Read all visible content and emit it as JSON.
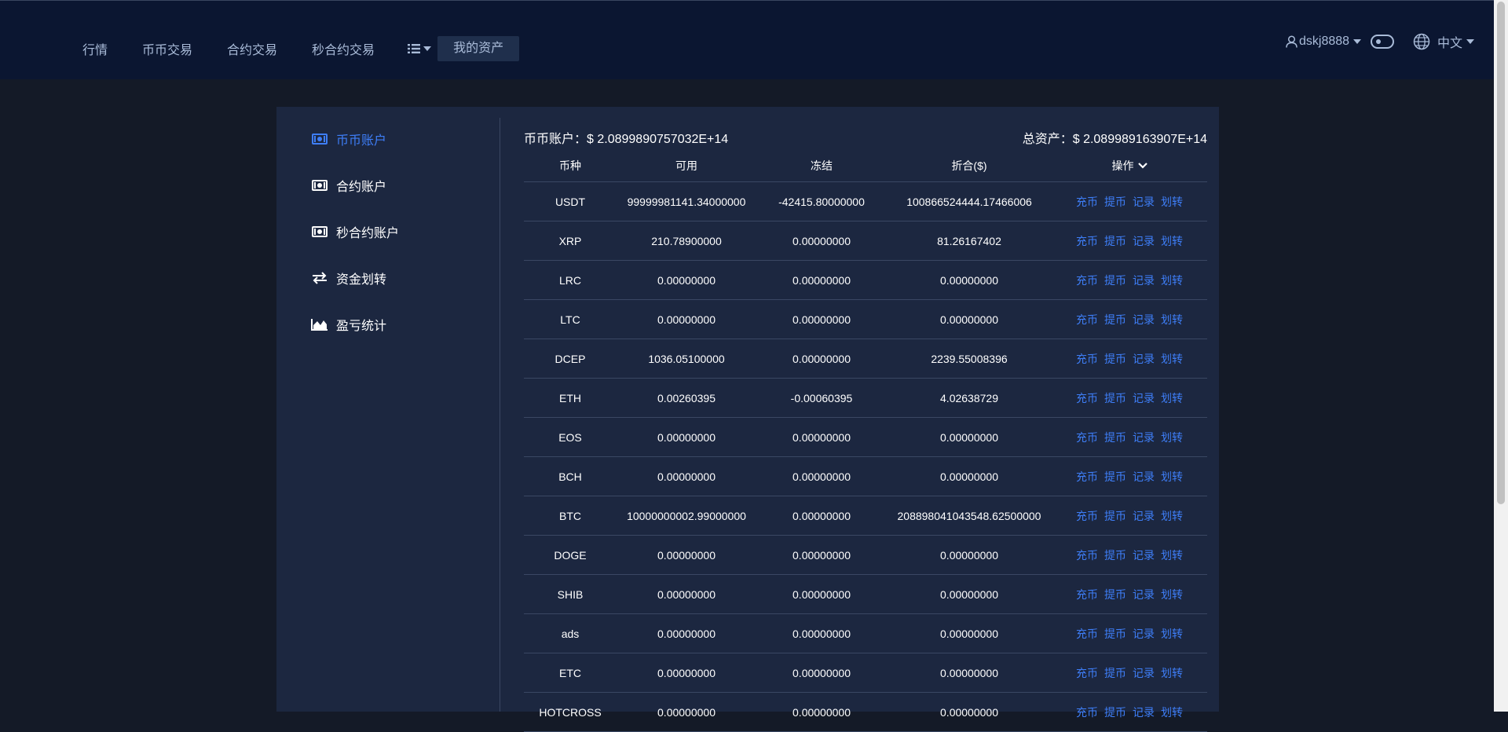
{
  "nav": {
    "items": [
      "行情",
      "币币交易",
      "合约交易",
      "秒合约交易"
    ],
    "list_icon": "list-icon",
    "active": "我的资产"
  },
  "user": {
    "icon": "user-icon",
    "name": "dskj8888",
    "language": "中文",
    "globe_icon": "globe-icon"
  },
  "sidebar": {
    "items": [
      {
        "label": "币币账户",
        "icon": "money-bill-icon",
        "active": true
      },
      {
        "label": "合约账户",
        "icon": "money-bill-icon",
        "active": false
      },
      {
        "label": "秒合约账户",
        "icon": "money-bill-icon",
        "active": false
      },
      {
        "label": "资金划转",
        "icon": "exchange-arrows-icon",
        "active": false
      },
      {
        "label": "盈亏统计",
        "icon": "area-chart-icon",
        "active": false
      }
    ]
  },
  "summary": {
    "account_label": "币币账户：",
    "account_value": "$ 2.0899890757032E+14",
    "total_label": "总资产：",
    "total_value": "$ 2.089989163907E+14"
  },
  "table": {
    "headers": [
      "币种",
      "可用",
      "冻结",
      "折合($)",
      "操作"
    ],
    "actions": [
      "充币",
      "提币",
      "记录",
      "划转"
    ],
    "rows": [
      [
        "USDT",
        "99999981141.34000000",
        "-42415.80000000",
        "100866524444.17466006"
      ],
      [
        "XRP",
        "210.78900000",
        "0.00000000",
        "81.26167402"
      ],
      [
        "LRC",
        "0.00000000",
        "0.00000000",
        "0.00000000"
      ],
      [
        "LTC",
        "0.00000000",
        "0.00000000",
        "0.00000000"
      ],
      [
        "DCEP",
        "1036.05100000",
        "0.00000000",
        "2239.55008396"
      ],
      [
        "ETH",
        "0.00260395",
        "-0.00060395",
        "4.02638729"
      ],
      [
        "EOS",
        "0.00000000",
        "0.00000000",
        "0.00000000"
      ],
      [
        "BCH",
        "0.00000000",
        "0.00000000",
        "0.00000000"
      ],
      [
        "BTC",
        "10000000002.99000000",
        "0.00000000",
        "208898041043548.62500000"
      ],
      [
        "DOGE",
        "0.00000000",
        "0.00000000",
        "0.00000000"
      ],
      [
        "SHIB",
        "0.00000000",
        "0.00000000",
        "0.00000000"
      ],
      [
        "ads",
        "0.00000000",
        "0.00000000",
        "0.00000000"
      ],
      [
        "ETC",
        "0.00000000",
        "0.00000000",
        "0.00000000"
      ],
      [
        "HOTCROSS",
        "0.00000000",
        "0.00000000",
        "0.00000000"
      ]
    ]
  },
  "colors": {
    "accent": "#3e7ef7",
    "topbar": "#0b1631",
    "panel": "#1c2740",
    "background": "#141a27"
  }
}
